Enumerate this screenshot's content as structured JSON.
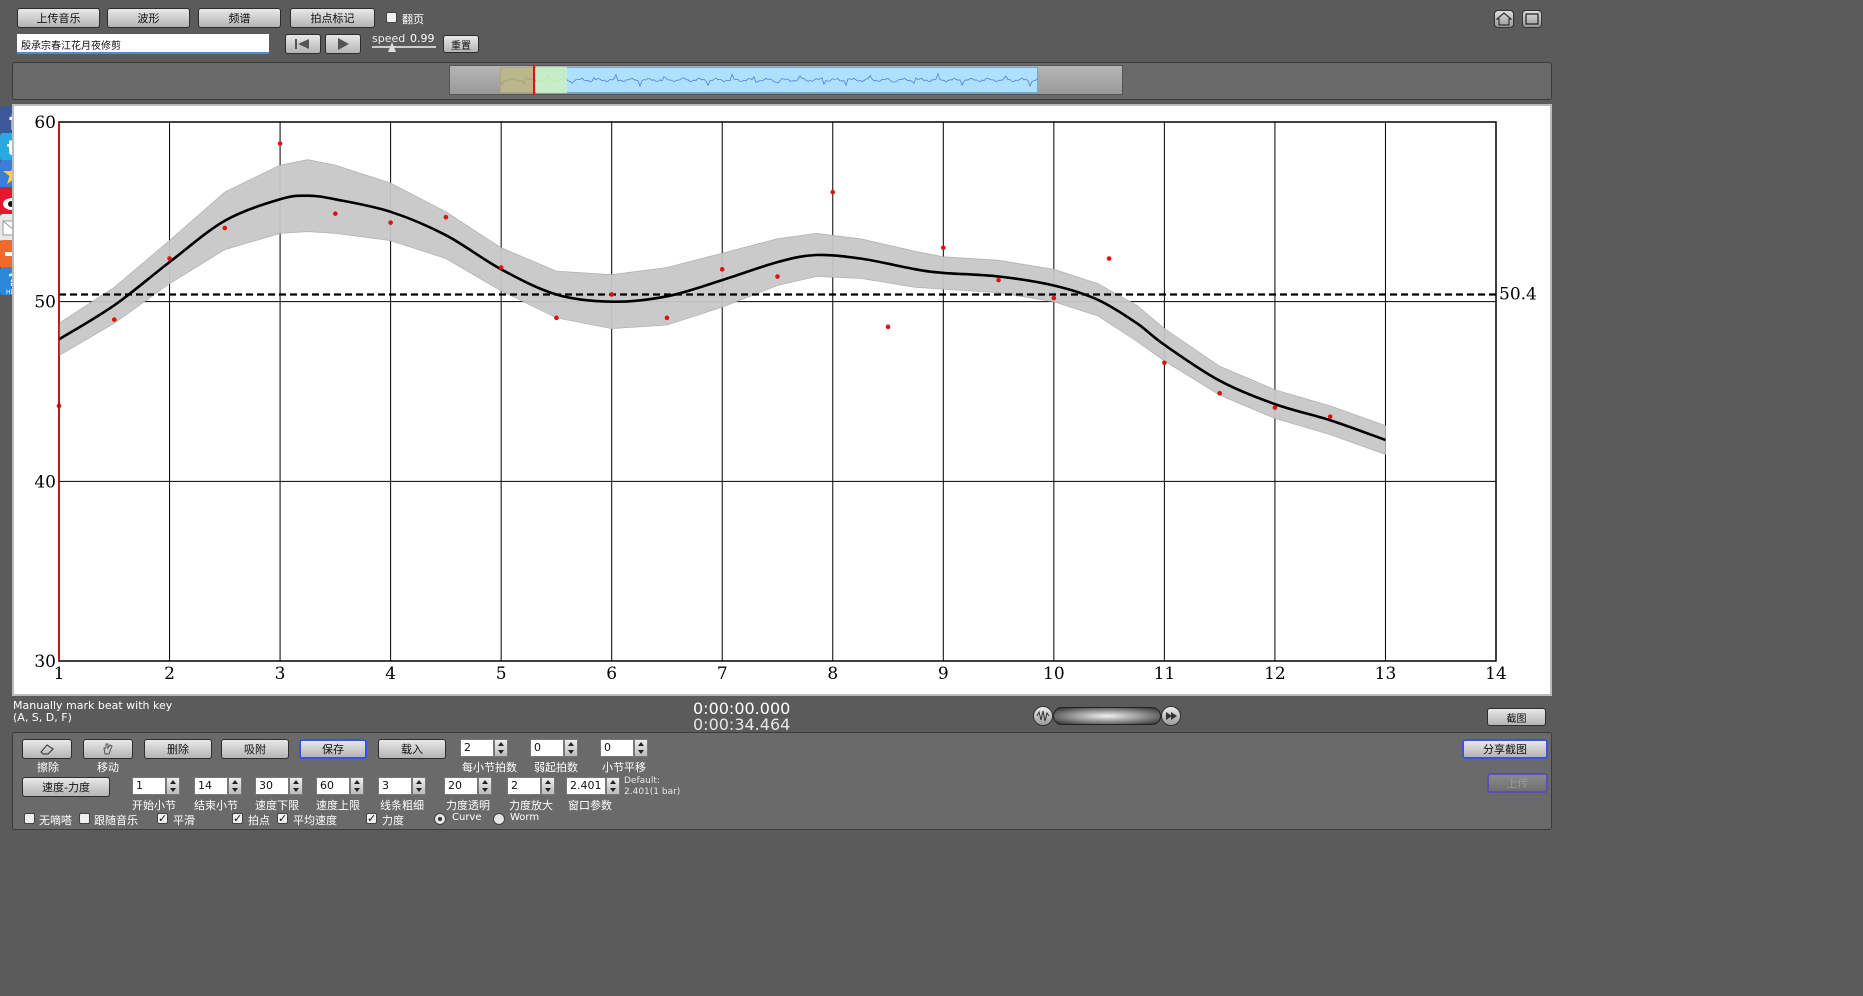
{
  "toolbar": {
    "upload_label": "上传音乐",
    "waveform_label": "波形",
    "spectrum_label": "频谱",
    "beat_mark_label": "拍点标记",
    "flip_label": "翻页",
    "song_title": "殷承宗春江花月夜修剪",
    "speed_label": "speed",
    "speed_value": "0.99",
    "reset_label": "重置"
  },
  "chart_data": {
    "type": "line",
    "xlim": [
      1,
      14
    ],
    "ylim": [
      30,
      60
    ],
    "xticks": [
      "1",
      "2",
      "3",
      "4",
      "5",
      "6",
      "7",
      "8",
      "9",
      "10",
      "11",
      "12",
      "13",
      "14"
    ],
    "yticks": [
      "30",
      "40",
      "50",
      "60"
    ],
    "reference_line": {
      "value": 50.4,
      "label": "50.4"
    },
    "grid": true,
    "beat_points": [
      {
        "x": 1.0,
        "y": 44.2
      },
      {
        "x": 1.5,
        "y": 49.0
      },
      {
        "x": 2.0,
        "y": 52.4
      },
      {
        "x": 2.5,
        "y": 54.1
      },
      {
        "x": 3.0,
        "y": 58.8
      },
      {
        "x": 3.5,
        "y": 54.9
      },
      {
        "x": 4.0,
        "y": 54.4
      },
      {
        "x": 4.5,
        "y": 54.7
      },
      {
        "x": 5.0,
        "y": 51.9
      },
      {
        "x": 5.5,
        "y": 49.1
      },
      {
        "x": 6.0,
        "y": 50.4
      },
      {
        "x": 6.5,
        "y": 49.1
      },
      {
        "x": 7.0,
        "y": 51.8
      },
      {
        "x": 7.5,
        "y": 51.4
      },
      {
        "x": 8.0,
        "y": 56.1
      },
      {
        "x": 8.5,
        "y": 48.6
      },
      {
        "x": 9.0,
        "y": 53.0
      },
      {
        "x": 9.5,
        "y": 51.2
      },
      {
        "x": 10.0,
        "y": 50.2
      },
      {
        "x": 10.5,
        "y": 52.4
      },
      {
        "x": 11.0,
        "y": 46.6
      },
      {
        "x": 11.5,
        "y": 44.9
      },
      {
        "x": 12.0,
        "y": 44.1
      },
      {
        "x": 12.5,
        "y": 43.6
      }
    ],
    "smooth_curve": [
      {
        "x": 1.0,
        "y": 47.9
      },
      {
        "x": 1.5,
        "y": 49.8
      },
      {
        "x": 2.0,
        "y": 52.2
      },
      {
        "x": 2.5,
        "y": 54.5
      },
      {
        "x": 3.0,
        "y": 55.7
      },
      {
        "x": 3.25,
        "y": 55.9
      },
      {
        "x": 3.5,
        "y": 55.7
      },
      {
        "x": 4.0,
        "y": 55.0
      },
      {
        "x": 4.5,
        "y": 53.7
      },
      {
        "x": 5.0,
        "y": 51.8
      },
      {
        "x": 5.5,
        "y": 50.4
      },
      {
        "x": 6.0,
        "y": 50.0
      },
      {
        "x": 6.5,
        "y": 50.3
      },
      {
        "x": 7.0,
        "y": 51.2
      },
      {
        "x": 7.5,
        "y": 52.2
      },
      {
        "x": 7.85,
        "y": 52.6
      },
      {
        "x": 8.25,
        "y": 52.4
      },
      {
        "x": 8.75,
        "y": 51.8
      },
      {
        "x": 9.0,
        "y": 51.6
      },
      {
        "x": 9.5,
        "y": 51.4
      },
      {
        "x": 10.0,
        "y": 50.9
      },
      {
        "x": 10.4,
        "y": 50.1
      },
      {
        "x": 10.75,
        "y": 48.8
      },
      {
        "x": 11.0,
        "y": 47.6
      },
      {
        "x": 11.5,
        "y": 45.6
      },
      {
        "x": 12.0,
        "y": 44.3
      },
      {
        "x": 12.5,
        "y": 43.4
      },
      {
        "x": 13.0,
        "y": 42.3
      }
    ],
    "band_halfwidth": [
      0.9,
      1.0,
      1.2,
      1.6,
      1.9,
      2.0,
      1.9,
      1.6,
      1.3,
      1.2,
      1.3,
      1.5,
      1.6,
      1.5,
      1.3,
      1.2,
      1.1,
      1.0,
      0.9,
      0.9,
      0.9,
      0.9,
      1.0,
      0.9,
      0.8,
      0.8,
      0.8,
      0.8
    ]
  },
  "status": {
    "hint_line1": "Manually mark beat with key",
    "hint_line2": "(A, S, D, F)",
    "time_current": "0:00:00.000",
    "time_total": "0:00:34.464",
    "screenshot_label": "截图"
  },
  "controls": {
    "erase_label": "擦除",
    "move_label": "移动",
    "delete_label": "删除",
    "snap_label": "吸附",
    "save_label": "保存",
    "load_label": "载入",
    "beats_per_bar_value": "2",
    "beats_per_bar_label": "每小节拍数",
    "upbeat_value": "0",
    "upbeat_label": "弱起拍数",
    "bar_shift_value": "0",
    "bar_shift_label": "小节平移",
    "tempo_dynamics_label": "速度-力度",
    "start_bar_value": "1",
    "start_bar_label": "开始小节",
    "end_bar_value": "14",
    "end_bar_label": "结束小节",
    "speed_min_value": "30",
    "speed_min_label": "速度下限",
    "speed_max_value": "60",
    "speed_max_label": "速度上限",
    "line_width_value": "3",
    "line_width_label": "线条粗细",
    "dyn_alpha_value": "20",
    "dyn_alpha_label": "力度透明",
    "dyn_scale_value": "2",
    "dyn_scale_label": "力度放大",
    "window_value": "2.401",
    "window_label": "窗口参数",
    "default_line1": "Default:",
    "default_line2": "2.401(1 bar)",
    "share_screenshot_label": "分享截图",
    "disabled_label": "上传",
    "no_beep_label": "无嘀嗒",
    "follow_music_label": "跟随音乐",
    "smooth_label": "平滑",
    "beat_points_label": "拍点",
    "avg_speed_label": "平均速度",
    "dynamics_label": "力度",
    "curve_label": "Curve",
    "worm_label": "Worm"
  },
  "colors": {
    "accent_red": "#e01010",
    "waveform_bg": "#aee0ff",
    "selection_green": "#c9f0c0"
  }
}
